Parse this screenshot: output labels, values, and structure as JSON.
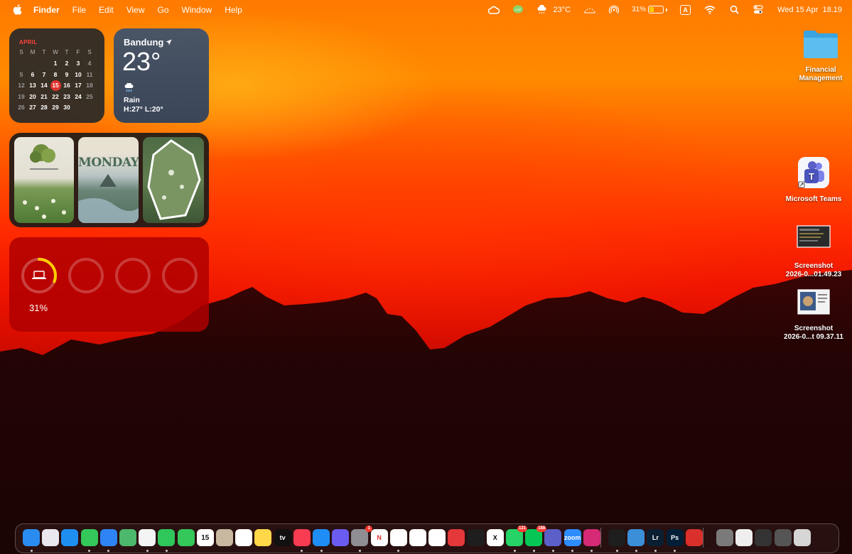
{
  "menubar": {
    "app_name": "Finder",
    "menus": [
      "File",
      "Edit",
      "View",
      "Go",
      "Window",
      "Help"
    ],
    "weather_temp": "23°C",
    "battery_percent": "31%",
    "input_source": "A",
    "clock": "Wed 15 Apr  18.19",
    "icons": [
      "apple-icon",
      "creative-cloud-icon",
      "line-icon",
      "weather-icon",
      "focus-icon",
      "airdrop-icon",
      "battery-icon",
      "input-source-icon",
      "wifi-icon",
      "search-icon",
      "control-center-icon"
    ]
  },
  "calendar_widget": {
    "month": "APRIL",
    "weekday_headers": [
      "S",
      "M",
      "T",
      "W",
      "T",
      "F",
      "S"
    ],
    "weeks": [
      [
        "",
        "",
        "",
        "1",
        "2",
        "3",
        "4"
      ],
      [
        "5",
        "6",
        "7",
        "8",
        "9",
        "10",
        "11"
      ],
      [
        "12",
        "13",
        "14",
        "15",
        "16",
        "17",
        "18"
      ],
      [
        "19",
        "20",
        "21",
        "22",
        "23",
        "24",
        "25"
      ],
      [
        "26",
        "27",
        "28",
        "29",
        "30",
        "",
        ""
      ]
    ],
    "today": "15"
  },
  "weather_widget": {
    "city": "Bandung",
    "temperature": "23°",
    "condition": "Rain",
    "high_low": "H:27° L:20°"
  },
  "photos_widget": {
    "photo_texts": [
      "MONDAY"
    ]
  },
  "batteries_widget": {
    "percent": "31%",
    "level": 0.31
  },
  "desktop_icons": [
    {
      "label_lines": [
        "Financial",
        "Management"
      ],
      "icon": "folder-icon"
    },
    {
      "label_lines": [
        "Microsoft Teams"
      ],
      "icon": "teams-icon"
    },
    {
      "label_lines": [
        "Screenshot",
        "2026-0...01.49.23"
      ],
      "icon": "screenshot-icon"
    },
    {
      "label_lines": [
        "Screenshot",
        "2026-0...t 09.37.11"
      ],
      "icon": "screenshot-icon"
    }
  ],
  "dock": {
    "apps": [
      {
        "name": "finder",
        "color": "#2a8cf0",
        "text": ""
      },
      {
        "name": "launchpad",
        "color": "#e8e8ee",
        "text": ""
      },
      {
        "name": "safari",
        "color": "#1f8ef1",
        "text": ""
      },
      {
        "name": "messages",
        "color": "#34c759",
        "text": ""
      },
      {
        "name": "mail",
        "color": "#2f84f5",
        "text": ""
      },
      {
        "name": "maps",
        "color": "#4cb86b",
        "text": ""
      },
      {
        "name": "photos",
        "color": "#f4f4f4",
        "text": ""
      },
      {
        "name": "facetime",
        "color": "#2fc65a",
        "text": ""
      },
      {
        "name": "phone",
        "color": "#34c759",
        "text": ""
      },
      {
        "name": "calendar",
        "color": "#ffffff",
        "text": "15"
      },
      {
        "name": "contacts",
        "color": "#c9b8a0",
        "text": ""
      },
      {
        "name": "reminders",
        "color": "#ffffff",
        "text": ""
      },
      {
        "name": "notes",
        "color": "#ffd84a",
        "text": ""
      },
      {
        "name": "apple-tv",
        "color": "#111111",
        "text": "tv"
      },
      {
        "name": "music",
        "color": "#fa3c52",
        "text": ""
      },
      {
        "name": "app-store",
        "color": "#1e8df5",
        "text": ""
      },
      {
        "name": "shortcuts",
        "color": "#6a5cf0",
        "text": ""
      },
      {
        "name": "system-settings",
        "color": "#8e8e93",
        "text": "",
        "badge": "1"
      },
      {
        "name": "netflix",
        "color": "#ffffff",
        "text": "N"
      },
      {
        "name": "youtube",
        "color": "#ffffff",
        "text": ""
      },
      {
        "name": "google-drive",
        "color": "#ffffff",
        "text": ""
      },
      {
        "name": "pinterest",
        "color": "#ffffff",
        "text": ""
      },
      {
        "name": "creative-cloud",
        "color": "#e5383b",
        "text": ""
      },
      {
        "name": "figma",
        "color": "#1e1e1e",
        "text": ""
      },
      {
        "name": "x",
        "color": "#ffffff",
        "text": "X"
      },
      {
        "name": "whatsapp",
        "color": "#25d366",
        "text": "",
        "badge": "121"
      },
      {
        "name": "line",
        "color": "#06c755",
        "text": "",
        "badge": "188"
      },
      {
        "name": "teams",
        "color": "#5b5fc7",
        "text": ""
      },
      {
        "name": "zoom",
        "color": "#2d8cff",
        "text": "zoom"
      },
      {
        "name": "instagram",
        "color": "#d62976",
        "text": ""
      },
      {
        "name": "activity-monitor",
        "color": "#1e1e1e",
        "text": ""
      },
      {
        "name": "backup",
        "color": "#3b8fd9",
        "text": ""
      },
      {
        "name": "lightroom",
        "color": "#0b1f33",
        "text": "Lr"
      },
      {
        "name": "photoshop",
        "color": "#001e36",
        "text": "Ps"
      },
      {
        "name": "scanner",
        "color": "#d9302b",
        "text": ""
      },
      {
        "name": "downloads-stack",
        "color": "#7a7a7a",
        "text": ""
      },
      {
        "name": "document-stack",
        "color": "#eeeeee",
        "text": ""
      },
      {
        "name": "folder-stack",
        "color": "#333333",
        "text": ""
      },
      {
        "name": "screenshot-stack",
        "color": "#555555",
        "text": ""
      },
      {
        "name": "trash",
        "color": "#d6d6d6",
        "text": ""
      }
    ]
  }
}
